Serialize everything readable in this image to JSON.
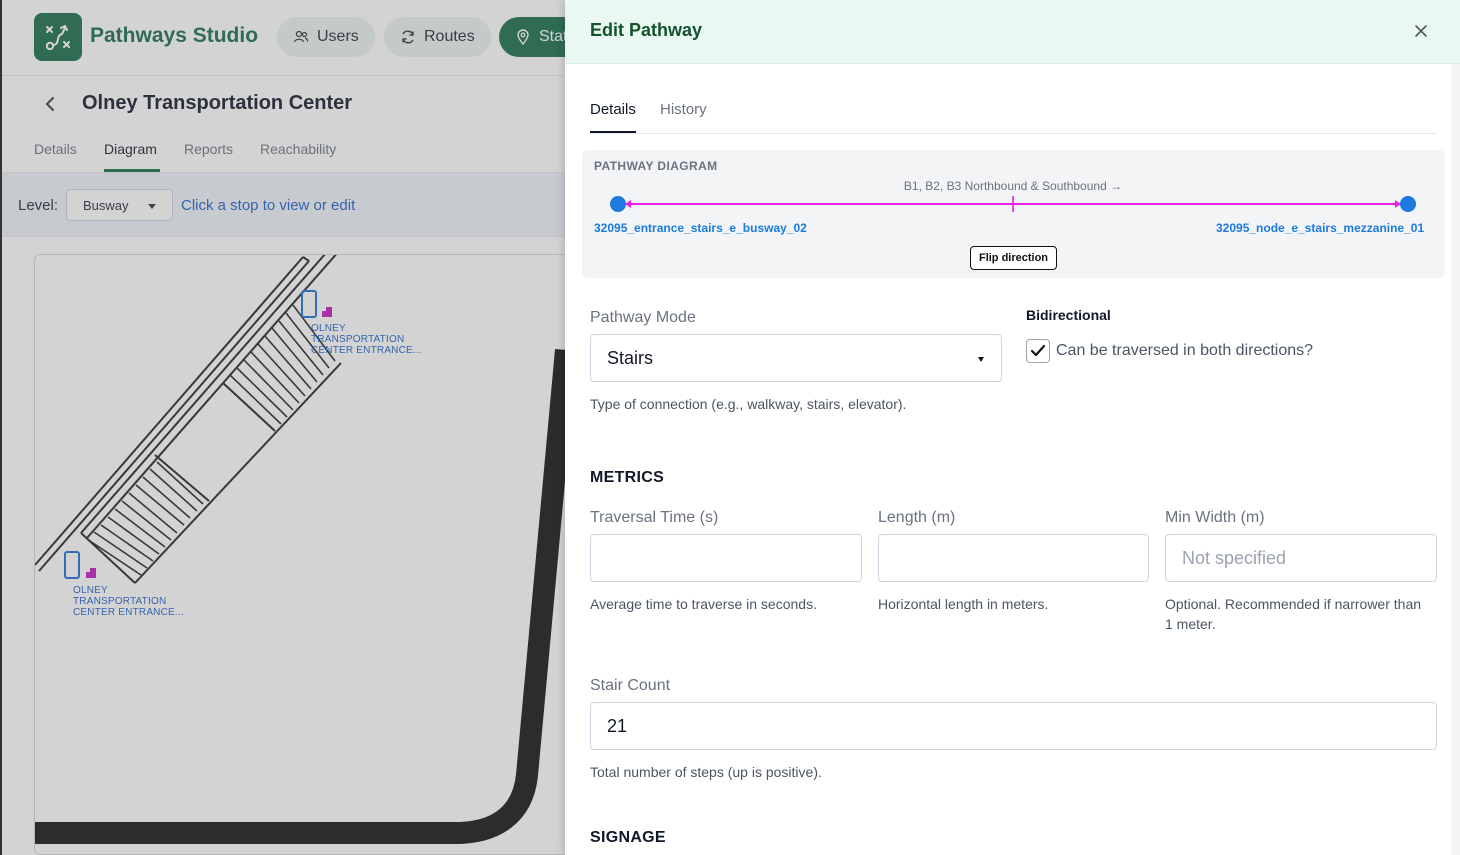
{
  "app": {
    "title": "Pathways Studio",
    "nav": [
      {
        "label": "Users",
        "icon": "users-icon"
      },
      {
        "label": "Routes",
        "icon": "refresh-icon"
      },
      {
        "label": "Stat",
        "icon": "location-pin-icon"
      }
    ]
  },
  "page": {
    "title": "Olney Transportation Center",
    "tabs": [
      "Details",
      "Diagram",
      "Reports",
      "Reachability"
    ],
    "active_tab": "Diagram",
    "level_label": "Level:",
    "level_value": "Busway",
    "hint": "Click a stop to view or edit",
    "stops": [
      {
        "label": "OLNEY TRANSPORTATION CENTER ENTRANCE..."
      },
      {
        "label": "OLNEY TRANSPORTATION CENTER ENTRANCE..."
      }
    ]
  },
  "drawer": {
    "title": "Edit Pathway",
    "tabs": [
      "Details",
      "History"
    ],
    "active_tab": "Details",
    "diagram": {
      "heading": "PATHWAY DIAGRAM",
      "route_label": "B1, B2, B3 Northbound & Southbound →",
      "from_node": "32095_entrance_stairs_e_busway_02",
      "to_node": "32095_node_e_stairs_mezzanine_01",
      "flip_label": "Flip direction",
      "arrow_color": "#e91ee6",
      "node_color": "#1d7be0"
    },
    "pathway_mode": {
      "label": "Pathway Mode",
      "value": "Stairs",
      "helper": "Type of connection (e.g., walkway, stairs, elevator)."
    },
    "bidirectional": {
      "label": "Bidirectional",
      "checkbox_label": "Can be traversed in both directions?",
      "checked": true
    },
    "metrics": {
      "title": "METRICS",
      "traversal_time": {
        "label": "Traversal Time (s)",
        "value": "",
        "helper": "Average time to traverse in seconds."
      },
      "length": {
        "label": "Length (m)",
        "value": "",
        "helper": "Horizontal length in meters."
      },
      "min_width": {
        "label": "Min Width (m)",
        "placeholder": "Not specified",
        "helper_line1": "Optional. Recommended if narrower than",
        "helper_line2": "1 meter."
      },
      "stair_count": {
        "label": "Stair Count",
        "value": "21",
        "helper": "Total number of steps (up is positive)."
      }
    },
    "signage": {
      "title": "SIGNAGE"
    }
  },
  "colors": {
    "brand": "#166a4a",
    "link": "#1d5fc9",
    "header_bg": "#e9f9f2"
  }
}
